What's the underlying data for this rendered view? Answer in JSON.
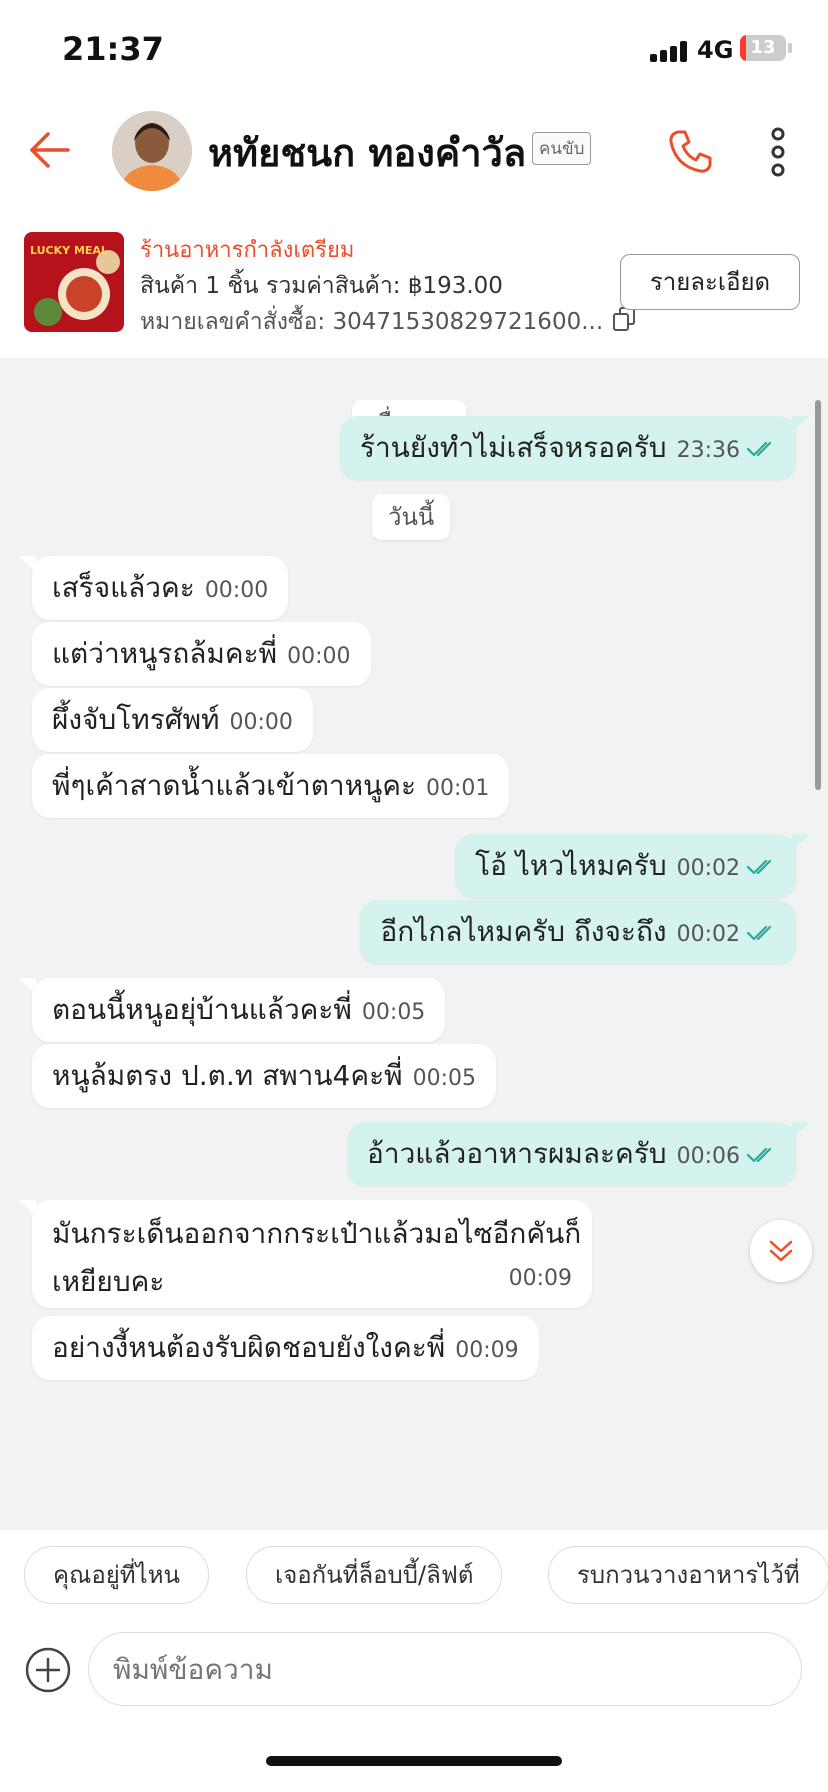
{
  "status_bar": {
    "time": "21:37",
    "network": "4G",
    "battery": "13"
  },
  "header": {
    "name": "หทัยชนก ทองคำวัล",
    "role": "คนขับ"
  },
  "order": {
    "status": "ร้านอาหารกำลังเตรียม",
    "summary": "สินค้า 1 ชิ้น รวมค่าสินค้า: ฿193.00",
    "order_number": "หมายเลขคำสั่งซื้อ: 30471530829721600...",
    "detail_button": "รายละเอียด",
    "thumb_text": "LUCKY MEAL"
  },
  "chat": {
    "date_yesterday": "เมื่อวาน",
    "date_today": "วันนี้",
    "messages": [
      {
        "dir": "out",
        "text": "ร้านยังทำไม่เสร็จหรอครับ",
        "time": "23:36"
      },
      {
        "dir": "in",
        "text": "เสร็จแล้วคะ",
        "time": "00:00"
      },
      {
        "dir": "in",
        "text": "แต่ว่าหนูรถล้มคะพี่",
        "time": "00:00"
      },
      {
        "dir": "in",
        "text": "ผึ้งจับโทรศัพท์",
        "time": "00:00"
      },
      {
        "dir": "in",
        "text": "พี่ๆเค้าสาดน้ำแล้วเข้าตาหนูคะ",
        "time": "00:01"
      },
      {
        "dir": "out",
        "text": "โอ้ ไหวไหมครับ",
        "time": "00:02"
      },
      {
        "dir": "out",
        "text": "อีกไกลไหมครับ ถึงจะถึง",
        "time": "00:02"
      },
      {
        "dir": "in",
        "text": "ตอนนี้หนูอยุ่บ้านแล้วคะพี่",
        "time": "00:05"
      },
      {
        "dir": "in",
        "text": "หนูล้มตรง ป.ต.ท สพาน4คะพี่",
        "time": "00:05"
      },
      {
        "dir": "out",
        "text": "อ้าวแล้วอาหารผมละครับ",
        "time": "00:06"
      },
      {
        "dir": "in",
        "text_line1": "มันกระเด็นออกจากกระเป๋าแล้วมอไซอีกคันก็",
        "text_line2": "เหยียบคะ",
        "time": "00:09"
      },
      {
        "dir": "in",
        "text": "อย่างงี้หนต้องรับผิดชอบยังใงคะพี่",
        "time": "00:09"
      }
    ]
  },
  "quick_replies": [
    "คุณอยู่ที่ไหน",
    "เจอกันที่ล็อบบี้/ลิฟต์",
    "รบกวนวางอาหารไว้ที่"
  ],
  "input": {
    "placeholder": "พิมพ์ข้อความ"
  },
  "colors": {
    "accent": "#ee4d2d",
    "outgoing": "#d5f3ee",
    "tick": "#26aa99",
    "chat_bg": "#f2f2f2"
  },
  "icons": [
    "back-arrow-icon",
    "phone-icon",
    "more-vertical-icon",
    "copy-icon",
    "double-check-icon",
    "chevrons-down-icon",
    "plus-circle-icon"
  ]
}
